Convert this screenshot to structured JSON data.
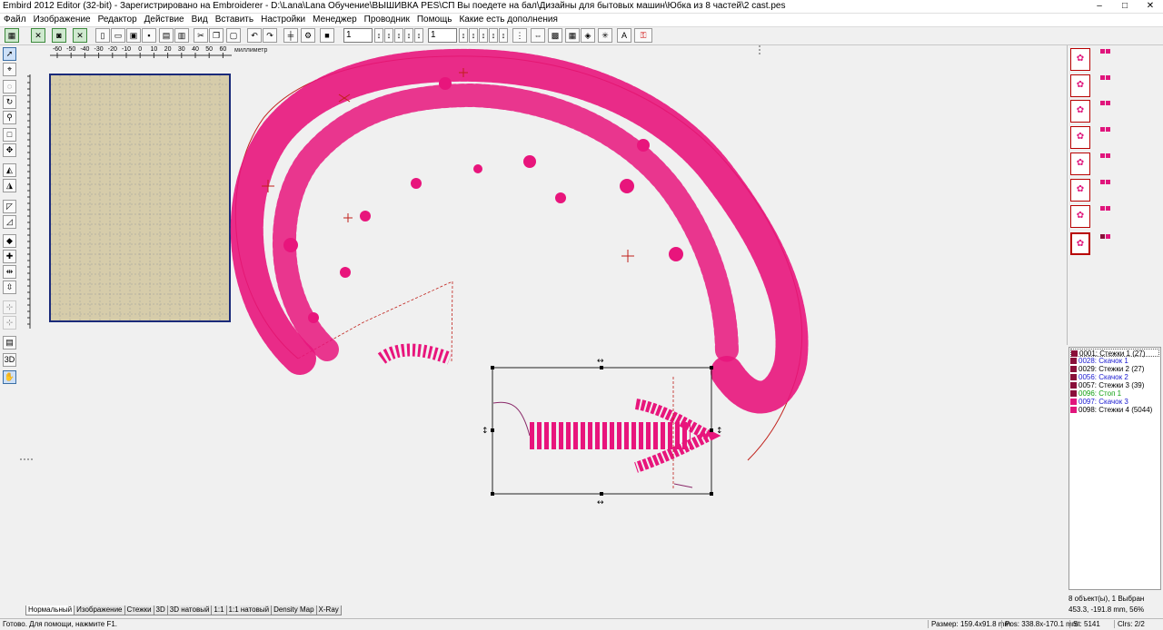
{
  "window": {
    "title": "Embird 2012 Editor (32-bit) - Зарегистрировано на Embroiderer - D:\\Lana\\Lana Обучение\\ВЫШИВКА PES\\СП Вы поедете на бал\\Дизайны для бытовых машин\\Юбка из 8 частей\\2 cast.pes",
    "min": "–",
    "max": "□",
    "close": "✕"
  },
  "menu": [
    "Файл",
    "Изображение",
    "Редактор",
    "Действие",
    "Вид",
    "Вставить",
    "Настройки",
    "Менеджер",
    "Проводник",
    "Помощь",
    "Какие есть дополнения"
  ],
  "toolbar": {
    "spin1": "1",
    "spin2": "1"
  },
  "ruler": {
    "unit": "миллиметр",
    "ticks": [
      "-60",
      "-50",
      "-40",
      "-30",
      "-20",
      "-10",
      "0",
      "10",
      "20",
      "30",
      "40",
      "50",
      "60"
    ]
  },
  "colors_list": [
    {
      "code": "0001:",
      "label": "Стежки 1 (27)",
      "swatch": "#8a0f3a",
      "text": "#000000"
    },
    {
      "code": "0028:",
      "label": "Скачок 1",
      "swatch": "#8a0f3a",
      "text": "#1a1ad0"
    },
    {
      "code": "0029:",
      "label": "Стежки 2 (27)",
      "swatch": "#8a0f3a",
      "text": "#000000"
    },
    {
      "code": "0056:",
      "label": "Скачок 2",
      "swatch": "#8a0f3a",
      "text": "#1a1ad0"
    },
    {
      "code": "0057:",
      "label": "Стежки 3 (39)",
      "swatch": "#8a0f3a",
      "text": "#000000"
    },
    {
      "code": "0096:",
      "label": "Стоп 1",
      "swatch": "#8a0f3a",
      "text": "#10a010"
    },
    {
      "code": "0097:",
      "label": "Скачок 3",
      "swatch": "#e0157c",
      "text": "#1a1ad0"
    },
    {
      "code": "0098:",
      "label": "Стежки 4 (5044)",
      "swatch": "#e0157c",
      "text": "#000000"
    }
  ],
  "objects_info": "8 объект(ы), 1 Выбран",
  "coords_info": "453.3, -191.8 mm, 56%",
  "tabs": [
    "Нормальный",
    "Изображение",
    "Стежки",
    "3D",
    "3D натовый",
    "1:1",
    "1:1 натовый",
    "Density Map",
    "X-Ray"
  ],
  "status": {
    "help": "Готово. Для помощи, нажмите F1.",
    "size": "Размер: 159.4x91.8 mm",
    "pos": "Pos: 338.8x-170.1 mm",
    "st": "St: 5141",
    "clrs": "Clrs: 2/2"
  },
  "accent": {
    "thread": "#e8157c",
    "hoop_fill": "#d6ccaa",
    "hoop_border": "#1a2a7a",
    "outline": "#c0201a"
  }
}
